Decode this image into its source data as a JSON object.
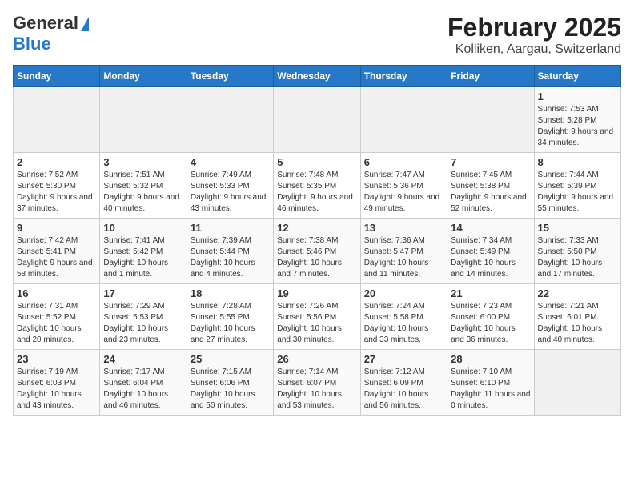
{
  "header": {
    "logo_line1": "General",
    "logo_line2": "Blue",
    "title": "February 2025",
    "subtitle": "Kolliken, Aargau, Switzerland"
  },
  "weekdays": [
    "Sunday",
    "Monday",
    "Tuesday",
    "Wednesday",
    "Thursday",
    "Friday",
    "Saturday"
  ],
  "weeks": [
    [
      {
        "day": "",
        "info": ""
      },
      {
        "day": "",
        "info": ""
      },
      {
        "day": "",
        "info": ""
      },
      {
        "day": "",
        "info": ""
      },
      {
        "day": "",
        "info": ""
      },
      {
        "day": "",
        "info": ""
      },
      {
        "day": "1",
        "info": "Sunrise: 7:53 AM\nSunset: 5:28 PM\nDaylight: 9 hours and 34 minutes."
      }
    ],
    [
      {
        "day": "2",
        "info": "Sunrise: 7:52 AM\nSunset: 5:30 PM\nDaylight: 9 hours and 37 minutes."
      },
      {
        "day": "3",
        "info": "Sunrise: 7:51 AM\nSunset: 5:32 PM\nDaylight: 9 hours and 40 minutes."
      },
      {
        "day": "4",
        "info": "Sunrise: 7:49 AM\nSunset: 5:33 PM\nDaylight: 9 hours and 43 minutes."
      },
      {
        "day": "5",
        "info": "Sunrise: 7:48 AM\nSunset: 5:35 PM\nDaylight: 9 hours and 46 minutes."
      },
      {
        "day": "6",
        "info": "Sunrise: 7:47 AM\nSunset: 5:36 PM\nDaylight: 9 hours and 49 minutes."
      },
      {
        "day": "7",
        "info": "Sunrise: 7:45 AM\nSunset: 5:38 PM\nDaylight: 9 hours and 52 minutes."
      },
      {
        "day": "8",
        "info": "Sunrise: 7:44 AM\nSunset: 5:39 PM\nDaylight: 9 hours and 55 minutes."
      }
    ],
    [
      {
        "day": "9",
        "info": "Sunrise: 7:42 AM\nSunset: 5:41 PM\nDaylight: 9 hours and 58 minutes."
      },
      {
        "day": "10",
        "info": "Sunrise: 7:41 AM\nSunset: 5:42 PM\nDaylight: 10 hours and 1 minute."
      },
      {
        "day": "11",
        "info": "Sunrise: 7:39 AM\nSunset: 5:44 PM\nDaylight: 10 hours and 4 minutes."
      },
      {
        "day": "12",
        "info": "Sunrise: 7:38 AM\nSunset: 5:46 PM\nDaylight: 10 hours and 7 minutes."
      },
      {
        "day": "13",
        "info": "Sunrise: 7:36 AM\nSunset: 5:47 PM\nDaylight: 10 hours and 11 minutes."
      },
      {
        "day": "14",
        "info": "Sunrise: 7:34 AM\nSunset: 5:49 PM\nDaylight: 10 hours and 14 minutes."
      },
      {
        "day": "15",
        "info": "Sunrise: 7:33 AM\nSunset: 5:50 PM\nDaylight: 10 hours and 17 minutes."
      }
    ],
    [
      {
        "day": "16",
        "info": "Sunrise: 7:31 AM\nSunset: 5:52 PM\nDaylight: 10 hours and 20 minutes."
      },
      {
        "day": "17",
        "info": "Sunrise: 7:29 AM\nSunset: 5:53 PM\nDaylight: 10 hours and 23 minutes."
      },
      {
        "day": "18",
        "info": "Sunrise: 7:28 AM\nSunset: 5:55 PM\nDaylight: 10 hours and 27 minutes."
      },
      {
        "day": "19",
        "info": "Sunrise: 7:26 AM\nSunset: 5:56 PM\nDaylight: 10 hours and 30 minutes."
      },
      {
        "day": "20",
        "info": "Sunrise: 7:24 AM\nSunset: 5:58 PM\nDaylight: 10 hours and 33 minutes."
      },
      {
        "day": "21",
        "info": "Sunrise: 7:23 AM\nSunset: 6:00 PM\nDaylight: 10 hours and 36 minutes."
      },
      {
        "day": "22",
        "info": "Sunrise: 7:21 AM\nSunset: 6:01 PM\nDaylight: 10 hours and 40 minutes."
      }
    ],
    [
      {
        "day": "23",
        "info": "Sunrise: 7:19 AM\nSunset: 6:03 PM\nDaylight: 10 hours and 43 minutes."
      },
      {
        "day": "24",
        "info": "Sunrise: 7:17 AM\nSunset: 6:04 PM\nDaylight: 10 hours and 46 minutes."
      },
      {
        "day": "25",
        "info": "Sunrise: 7:15 AM\nSunset: 6:06 PM\nDaylight: 10 hours and 50 minutes."
      },
      {
        "day": "26",
        "info": "Sunrise: 7:14 AM\nSunset: 6:07 PM\nDaylight: 10 hours and 53 minutes."
      },
      {
        "day": "27",
        "info": "Sunrise: 7:12 AM\nSunset: 6:09 PM\nDaylight: 10 hours and 56 minutes."
      },
      {
        "day": "28",
        "info": "Sunrise: 7:10 AM\nSunset: 6:10 PM\nDaylight: 11 hours and 0 minutes."
      },
      {
        "day": "",
        "info": ""
      }
    ]
  ]
}
